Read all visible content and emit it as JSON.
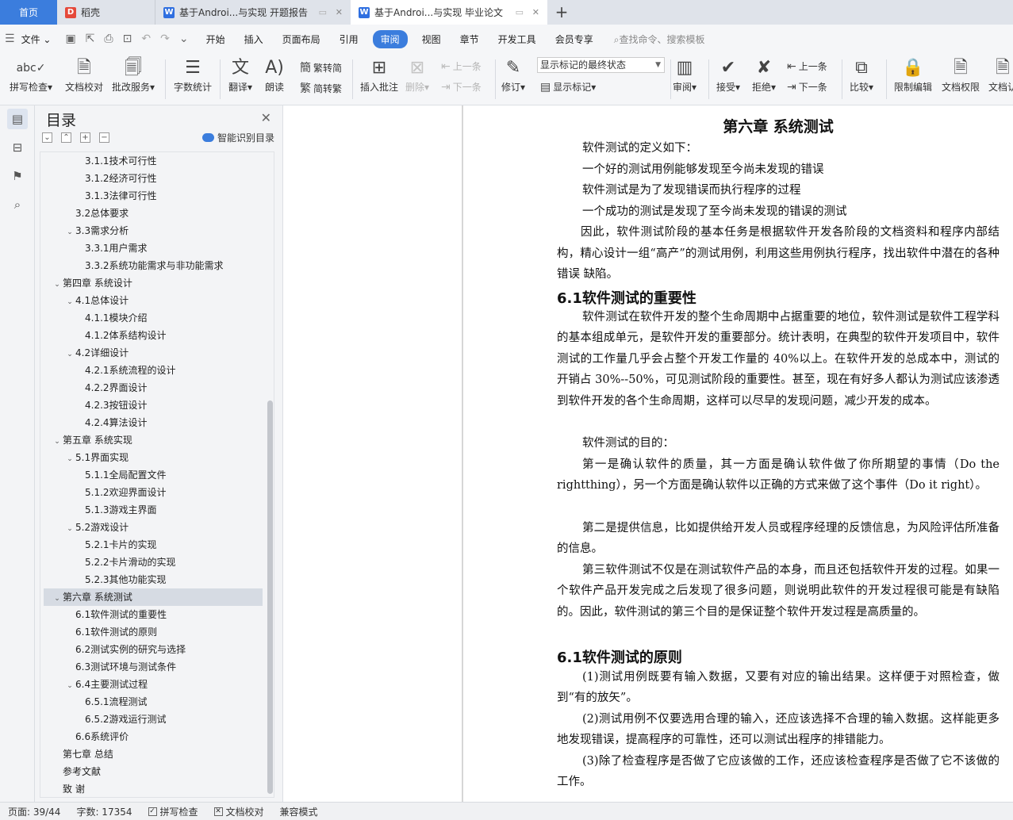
{
  "tabs": [
    {
      "label": "首页",
      "type": "home"
    },
    {
      "label": "稻壳",
      "type": "docer"
    },
    {
      "label": "基于Androi...与实现 开题报告",
      "type": "word"
    },
    {
      "label": "基于Androi...与实现 毕业论文",
      "type": "word",
      "active": true
    }
  ],
  "menu": {
    "file": "文件",
    "items": [
      "开始",
      "插入",
      "页面布局",
      "引用",
      "审阅",
      "视图",
      "章节",
      "开发工具",
      "会员专享"
    ],
    "active": "审阅",
    "search": "查找命令、搜索模板"
  },
  "ribbon": {
    "spell": "拼写检查",
    "proof": "文档校对",
    "batch": "批改服务",
    "wordcount": "字数统计",
    "translate": "翻译",
    "read": "朗读",
    "t2s": "繁转简",
    "s2t": "简转繁",
    "insert_comment": "插入批注",
    "delete": "删除",
    "prev": "上一条",
    "next": "下一条",
    "track": "修订",
    "markup_state": "显示标记的最终状态",
    "show_markup": "显示标记",
    "review": "审阅",
    "accept": "接受",
    "reject": "拒绝",
    "prev2": "上一条",
    "next2": "下一条",
    "compare": "比较",
    "restrict": "限制编辑",
    "permission": "文档权限",
    "cert": "文档认"
  },
  "toc": {
    "title": "目录",
    "smart": "智能识别目录",
    "items": [
      {
        "label": "3.1.1技术可行性",
        "level": 3
      },
      {
        "label": "3.1.2经济可行性",
        "level": 3
      },
      {
        "label": "3.1.3法律可行性",
        "level": 3
      },
      {
        "label": "3.2总体要求",
        "level": 2
      },
      {
        "label": "3.3需求分析",
        "level": 2,
        "exp": true
      },
      {
        "label": "3.3.1用户需求",
        "level": 3
      },
      {
        "label": "3.3.2系统功能需求与非功能需求",
        "level": 3
      },
      {
        "label": "第四章 系统设计",
        "level": 1,
        "exp": true
      },
      {
        "label": "4.1总体设计",
        "level": 2,
        "exp": true
      },
      {
        "label": "4.1.1模块介绍",
        "level": 3
      },
      {
        "label": "4.1.2体系结构设计",
        "level": 3
      },
      {
        "label": "4.2详细设计",
        "level": 2,
        "exp": true
      },
      {
        "label": "4.2.1系统流程的设计",
        "level": 3
      },
      {
        "label": "4.2.2界面设计",
        "level": 3
      },
      {
        "label": "4.2.3按钮设计",
        "level": 3
      },
      {
        "label": "4.2.4算法设计",
        "level": 3
      },
      {
        "label": "第五章 系统实现",
        "level": 1,
        "exp": true
      },
      {
        "label": "5.1界面实现",
        "level": 2,
        "exp": true
      },
      {
        "label": "5.1.1全局配置文件",
        "level": 3
      },
      {
        "label": "5.1.2欢迎界面设计",
        "level": 3
      },
      {
        "label": "5.1.3游戏主界面",
        "level": 3
      },
      {
        "label": "5.2游戏设计",
        "level": 2,
        "exp": true
      },
      {
        "label": "5.2.1卡片的实现",
        "level": 3
      },
      {
        "label": "5.2.2卡片滑动的实现",
        "level": 3
      },
      {
        "label": "5.2.3其他功能实现",
        "level": 3
      },
      {
        "label": "第六章 系统测试",
        "level": 1,
        "exp": true,
        "selected": true
      },
      {
        "label": "6.1软件测试的重要性",
        "level": 2
      },
      {
        "label": "6.1软件测试的原则",
        "level": 2
      },
      {
        "label": "6.2测试实例的研究与选择",
        "level": 2
      },
      {
        "label": "6.3测试环境与测试条件",
        "level": 2
      },
      {
        "label": "6.4主要测试过程",
        "level": 2,
        "exp": true
      },
      {
        "label": "6.5.1流程测试",
        "level": 3
      },
      {
        "label": "6.5.2游戏运行测试",
        "level": 3
      },
      {
        "label": "6.6系统评价",
        "level": 2
      },
      {
        "label": "第七章 总结",
        "level": 1
      },
      {
        "label": "参考文献",
        "level": 1
      },
      {
        "label": "致  谢",
        "level": 1
      }
    ]
  },
  "document": {
    "chapter_title": "第六章 系统测试",
    "p_def": "软件测试的定义如下：",
    "p_def1": "一个好的测试用例能够发现至今尚未发现的错误",
    "p_def2": "软件测试是为了发现错误而执行程序的过程",
    "p_def3": "一个成功的测试是发现了至今尚未发现的错误的测试",
    "p_task": "因此，软件测试阶段的基本任务是根据软件开发各阶段的文档资料和程序内部结构，精心设计一组“高产”的测试用例，利用这些用例执行程序，找出软件中潜在的各种错误 缺陷。",
    "h_importance": "6.1软件测试的重要性",
    "p_imp": "软件测试在软件开发的整个生命周期中占据重要的地位，软件测试是软件工程学科的基本组成单元，是软件开发的重要部分。统计表明，在典型的软件开发项目中，软件测试的工作量几乎会占整个开发工作量的 40%以上。在软件开发的总成本中，测试的开销占 30%--50%，可见测试阶段的重要性。甚至，现在有好多人都认为测试应该渗透到软件开发的各个生命周期，这样可以尽早的发现问题，减少开发的成本。",
    "p_purpose": "软件测试的目的：",
    "p_first": "第一是确认软件的质量，其一方面是确认软件做了你所期望的事情（Do the rightthing），另一个方面是确认软件以正确的方式来做了这个事件（Do it right）。",
    "p_second": "第二是提供信息，比如提供给开发人员或程序经理的反馈信息，为风险评估所准备的信息。",
    "p_third": "第三软件测试不仅是在测试软件产品的本身，而且还包括软件开发的过程。如果一个软件产品开发完成之后发现了很多问题，则说明此软件的开发过程很可能是有缺陷的。因此，软件测试的第三个目的是保证整个软件开发过程是高质量的。",
    "h_principle": "6.1软件测试的原则",
    "p_pr1": "(1)测试用例既要有输入数据，又要有对应的输出结果。这样便于对照检查，做到“有的放矢”。",
    "p_pr2": "(2)测试用例不仅要选用合理的输入，还应该选择不合理的输入数据。这样能更多地发现错误，提高程序的可靠性，还可以测试出程序的排错能力。",
    "p_pr3": "(3)除了检查程序是否做了它应该做的工作，还应该检查程序是否做了它不该做的工作。"
  },
  "status": {
    "page": "页面: 39/44",
    "words": "字数: 17354",
    "spell": "拼写检查",
    "proof": "文档校对",
    "compat": "兼容模式"
  }
}
